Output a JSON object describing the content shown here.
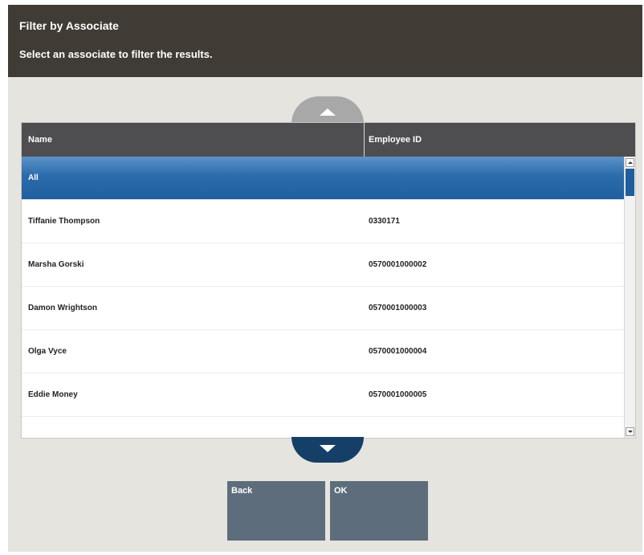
{
  "header": {
    "title": "Filter by Associate",
    "subtitle": "Select an associate to filter the results."
  },
  "table": {
    "columns": [
      "Name",
      "Employee ID"
    ],
    "rows": [
      {
        "name": "All",
        "employee_id": "",
        "selected": true
      },
      {
        "name": "Tiffanie Thompson",
        "employee_id": "0330171"
      },
      {
        "name": "Marsha Gorski",
        "employee_id": "0570001000002"
      },
      {
        "name": "Damon Wrightson",
        "employee_id": "0570001000003"
      },
      {
        "name": "Olga Vyce",
        "employee_id": "0570001000004"
      },
      {
        "name": "Eddie Money",
        "employee_id": "0570001000005"
      }
    ]
  },
  "buttons": {
    "back": "Back",
    "ok": "OK"
  },
  "colors": {
    "header_bg": "#403b34",
    "table_header_bg": "#4e4e50",
    "selected_row": "#2a6bab",
    "scroll_up_button": "#a8a8a8",
    "scroll_down_button": "#153f66",
    "action_button": "#5d6d7b"
  },
  "icons": {
    "scroll_up": "triangle-up-icon",
    "scroll_down": "triangle-down-icon"
  }
}
